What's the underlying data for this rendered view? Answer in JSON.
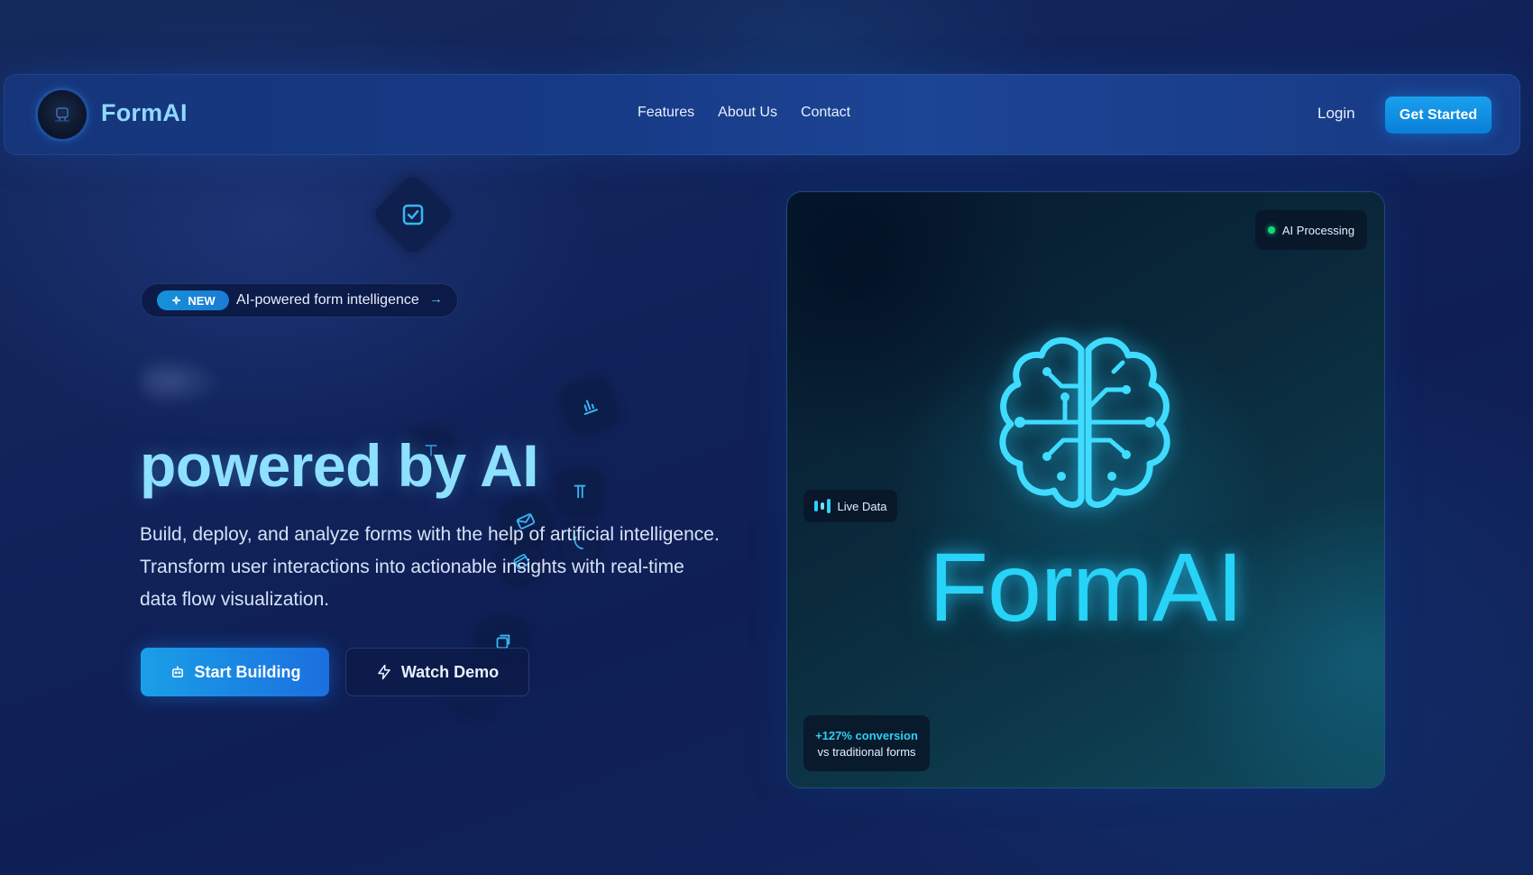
{
  "navbar": {
    "brand": "FormAI",
    "links": [
      "Features",
      "About Us",
      "Contact"
    ],
    "login": "Login",
    "cta": "Get Started"
  },
  "hero": {
    "pill": {
      "tag": "NEW",
      "text": "AI-powered form intelligence",
      "arrow": "→"
    },
    "headline": "powered by AI",
    "description": "Build, deploy, and analyze forms with the help of artificial intelligence. Transform user interactions into actionable insights with real-time data flow visualization.",
    "primary_button": "Start Building",
    "secondary_button": "Watch Demo"
  },
  "card": {
    "status_badge": "AI Processing",
    "live_badge": "Live Data",
    "title": "FormAI",
    "stat_main": "+127% conversion",
    "stat_sub": "vs traditional forms"
  },
  "colors": {
    "accent": "#1a9fe6",
    "headline": "#8ee0ff",
    "glow": "#27d3f7",
    "status_dot": "#19d67c"
  },
  "icons": [
    "brain-chip-icon",
    "sparkle-icon",
    "arrow-right-icon",
    "bot-icon",
    "lightning-icon",
    "checkbox-icon",
    "chart-icon",
    "text-icon",
    "paragraph-icon",
    "mail-icon",
    "phone-icon",
    "calendar-icon",
    "copy-icon",
    "live-bars-icon",
    "brain-circuit-icon"
  ]
}
